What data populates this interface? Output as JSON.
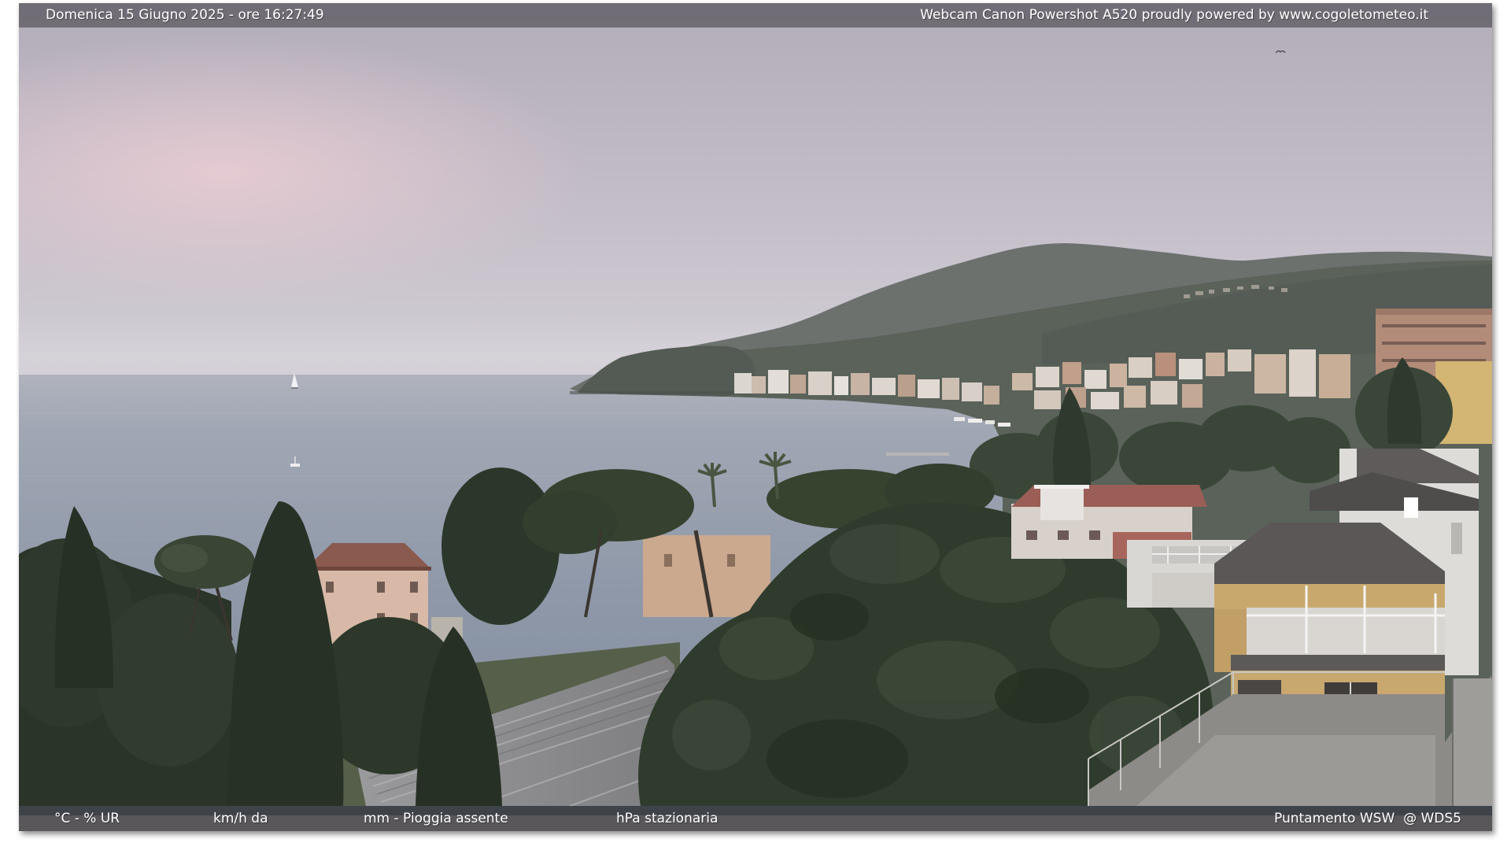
{
  "header": {
    "datetime": "Domenica 15 Giugno 2025 - ore 16:27:49",
    "credits": "Webcam Canon Powershot A520 proudly powered by www.cogoletometeo.it"
  },
  "footer": {
    "items": [
      {
        "icon": "thermometer-icon",
        "label": "°C - % UR"
      },
      {
        "icon": "windsock-icon",
        "label": "km/h da"
      },
      {
        "icon": "rain-cloud-icon",
        "label": "mm - Pioggia assente"
      },
      {
        "icon": "barometer-icon",
        "label": "hPa stazionaria"
      }
    ],
    "pointing": "Puntamento WSW  @ WDS5"
  },
  "colors": {
    "overlay_text": "#ffffff",
    "header_bar": "#6f6d73",
    "footer_bar": "#2a2d2a",
    "accent_red": "#d52b2b"
  }
}
